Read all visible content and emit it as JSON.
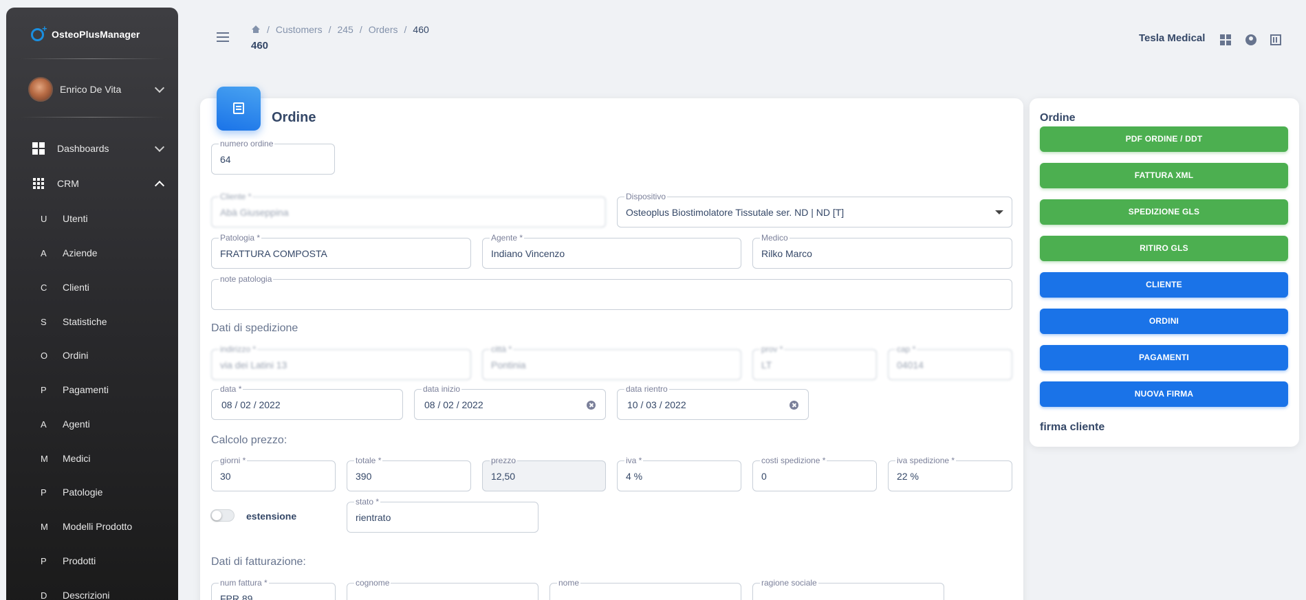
{
  "app": {
    "name": "OsteoPlusManager"
  },
  "user": {
    "name": "Enrico De Vita"
  },
  "sidebar": {
    "groups": {
      "dashboards": "Dashboards",
      "crm": "CRM"
    },
    "items": [
      {
        "letter": "U",
        "label": "Utenti"
      },
      {
        "letter": "A",
        "label": "Aziende"
      },
      {
        "letter": "C",
        "label": "Clienti"
      },
      {
        "letter": "S",
        "label": "Statistiche"
      },
      {
        "letter": "O",
        "label": "Ordini"
      },
      {
        "letter": "P",
        "label": "Pagamenti"
      },
      {
        "letter": "A",
        "label": "Agenti"
      },
      {
        "letter": "M",
        "label": "Medici"
      },
      {
        "letter": "P",
        "label": "Patologie"
      },
      {
        "letter": "M",
        "label": "Modelli Prodotto"
      },
      {
        "letter": "P",
        "label": "Prodotti"
      },
      {
        "letter": "D",
        "label": "Descrizioni"
      }
    ]
  },
  "header": {
    "breadcrumb": [
      "Customers",
      "245",
      "Orders",
      "460"
    ],
    "title": "460",
    "organization": "Tesla Medical"
  },
  "form": {
    "title": "Ordine",
    "numero_ordine": {
      "label": "numero ordine",
      "value": "64"
    },
    "cliente": {
      "label": "Cliente *",
      "value": "Abà Giuseppina"
    },
    "dispositivo": {
      "label": "Dispositivo",
      "value": "Osteoplus Biostimolatore Tissutale ser. ND | ND [T]"
    },
    "patologia": {
      "label": "Patologia *",
      "value": "FRATTURA COMPOSTA"
    },
    "agente": {
      "label": "Agente *",
      "value": "Indiano Vincenzo"
    },
    "medico": {
      "label": "Medico",
      "value": "Rilko Marco"
    },
    "note_patologia": {
      "label": "note patologia",
      "value": ""
    },
    "shipping_title": "Dati di spedizione",
    "indirizzo": {
      "label": "indirizzo *",
      "value": "via dei Latini 13"
    },
    "citta": {
      "label": "città *",
      "value": "Pontinia"
    },
    "prov": {
      "label": "prov *",
      "value": "LT"
    },
    "cap": {
      "label": "cap *",
      "value": "04014"
    },
    "data": {
      "label": "data *",
      "value": "08 / 02 / 2022"
    },
    "data_inizio": {
      "label": "data inizio",
      "value": "08 / 02 / 2022"
    },
    "data_rientro": {
      "label": "data rientro",
      "value": "10 / 03 / 2022"
    },
    "price_title": "Calcolo prezzo:",
    "giorni": {
      "label": "giorni *",
      "value": "30"
    },
    "totale": {
      "label": "totale *",
      "value": "390"
    },
    "prezzo": {
      "label": "prezzo",
      "value": "12,50"
    },
    "iva": {
      "label": "iva *",
      "value": "4 %"
    },
    "costi_spedizione": {
      "label": "costi spedizione *",
      "value": "0"
    },
    "iva_spedizione": {
      "label": "iva spedizione *",
      "value": "22 %"
    },
    "estensione": {
      "label": "estensione",
      "checked": false
    },
    "stato": {
      "label": "stato *",
      "value": "rientrato"
    },
    "billing_title": "Dati di fatturazione:",
    "num_fattura": {
      "label": "num fattura *",
      "value": "FPR 89"
    },
    "cognome": {
      "label": "cognome",
      "value": ""
    },
    "nome": {
      "label": "nome",
      "value": ""
    },
    "ragione_sociale": {
      "label": "ragione sociale",
      "value": ""
    }
  },
  "actions": {
    "title": "Ordine",
    "buttons": [
      {
        "label": "PDF ORDINE / DDT",
        "color": "#4caf50"
      },
      {
        "label": "FATTURA XML",
        "color": "#4caf50"
      },
      {
        "label": "SPEDIZIONE GLS",
        "color": "#4caf50"
      },
      {
        "label": "RITIRO GLS",
        "color": "#4caf50"
      },
      {
        "label": "CLIENTE",
        "color": "#1a73e8"
      },
      {
        "label": "ORDINI",
        "color": "#1a73e8"
      },
      {
        "label": "PAGAMENTI",
        "color": "#1a73e8"
      },
      {
        "label": "NUOVA FIRMA",
        "color": "#1a73e8"
      }
    ],
    "signature_label": "firma cliente"
  }
}
